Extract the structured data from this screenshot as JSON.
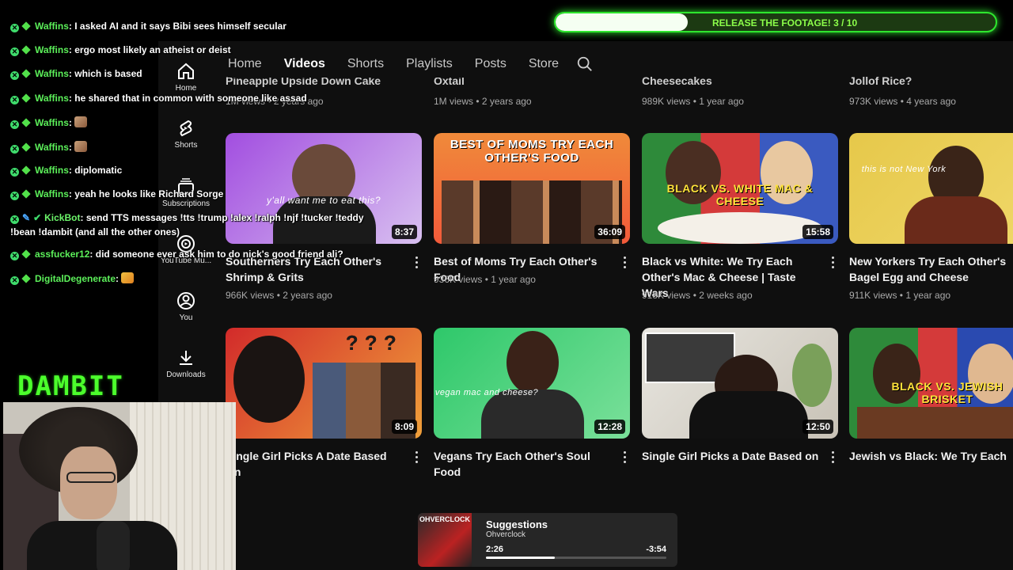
{
  "chat": {
    "messages": [
      {
        "user": "Waffins",
        "text": "I asked AI and it says Bibi sees himself secular"
      },
      {
        "user": "Waffins",
        "text": "ergo most likely an atheist or deist"
      },
      {
        "user": "Waffins",
        "text": "which is based"
      },
      {
        "user": "Waffins",
        "text": "he shared that in common with someone like assad"
      },
      {
        "user": "Waffins",
        "text": ""
      },
      {
        "user": "Waffins",
        "text": ""
      },
      {
        "user": "Waffins",
        "text": "diplomatic"
      },
      {
        "user": "Waffins",
        "text": "yeah he looks like Richard Sorge"
      },
      {
        "user": "KickBot",
        "text": "send TTS messages !tts !trump !alex !ralph !njf !tucker !teddy",
        "text2": "!bean !dambit (and all the other ones)"
      },
      {
        "user": "assfucker12",
        "text": "did someone ever ask him to do nick's good friend ali?"
      },
      {
        "user": "DigitalDegenerate",
        "text": ""
      }
    ]
  },
  "goal": {
    "label": "RELEASE THE FOOTAGE! 3 / 10",
    "progress": 0.3
  },
  "brand": "DAMBIT",
  "youtube": {
    "rail": [
      {
        "icon": "home-icon",
        "label": "Home"
      },
      {
        "icon": "shorts-icon",
        "label": "Shorts"
      },
      {
        "icon": "subscriptions-icon",
        "label": "Subscriptions"
      },
      {
        "icon": "youtube-music-icon",
        "label": "YouTube Mu..."
      },
      {
        "icon": "you-icon",
        "label": "You"
      },
      {
        "icon": "downloads-icon",
        "label": "Downloads"
      }
    ],
    "tabs": [
      {
        "label": "Home",
        "active": false
      },
      {
        "label": "Videos",
        "active": true
      },
      {
        "label": "Shorts",
        "active": false
      },
      {
        "label": "Playlists",
        "active": false
      },
      {
        "label": "Posts",
        "active": false
      },
      {
        "label": "Store",
        "active": false
      }
    ],
    "top_row": [
      {
        "title": "Pineapple Upside Down Cake",
        "meta": "1M views • 2 years ago"
      },
      {
        "title": "Oxtail",
        "meta": "1M views • 2 years ago"
      },
      {
        "title": "Cheesecakes",
        "meta": "989K views • 1 year ago"
      },
      {
        "title": "Jollof Rice?",
        "meta": "973K views • 4 years ago"
      }
    ],
    "row1": [
      {
        "thumb_text": "y'all want me to eat this?",
        "duration": "8:37",
        "title": "Southerners Try Each Other's Shrimp & Grits",
        "meta": "966K views • 2 years ago",
        "color1": "#a24ee0",
        "color2": "#d8c0f0"
      },
      {
        "thumb_text": "BEST OF MOMS TRY EACH OTHER'S FOOD",
        "duration": "36:09",
        "title": "Best of Moms Try Each Other's Food",
        "meta": "936K views • 1 year ago",
        "color1": "#f08a3a",
        "color2": "#f25a3a"
      },
      {
        "thumb_text": "BLACK VS. WHITE MAC & CHEESE",
        "duration": "15:58",
        "title": "Black vs White: We Try Each Other's Mac & Cheese | Taste Wars",
        "meta": "918K views • 2 weeks ago",
        "color1": "#2e8a3a",
        "color2": "#d43a3a"
      },
      {
        "thumb_text": "this is not New York",
        "duration": "",
        "title": "New Yorkers Try Each Other's Bagel Egg and Cheese",
        "meta": "911K views • 1 year ago",
        "color1": "#e6c84a",
        "color2": "#f0d86a"
      }
    ],
    "row2": [
      {
        "thumb_text": "? ? ?",
        "duration": "8:09",
        "title": "Single Girl Picks A Date Based On",
        "color1": "#d22a2a",
        "color2": "#f0a03a"
      },
      {
        "thumb_text": "vegan mac and cheese?",
        "duration": "12:28",
        "title": "Vegans Try Each Other's Soul Food",
        "color1": "#2ec86a",
        "color2": "#7ae09a"
      },
      {
        "thumb_text": "",
        "duration": "12:50",
        "title": "Single Girl Picks a Date Based on",
        "color1": "#e8e6e0",
        "color2": "#c8c2b6"
      },
      {
        "thumb_text": "BLACK VS. JEWISH BRISKET",
        "duration": "",
        "title": "Jewish vs Black: We Try Each",
        "color1": "#2e8a3a",
        "color2": "#2a4ab0"
      }
    ]
  },
  "player": {
    "album_label": "OHVERCLOCK",
    "title": "Suggestions",
    "artist": "Ohverclock",
    "elapsed": "2:26",
    "remaining": "-3:54",
    "progress": 0.38
  }
}
